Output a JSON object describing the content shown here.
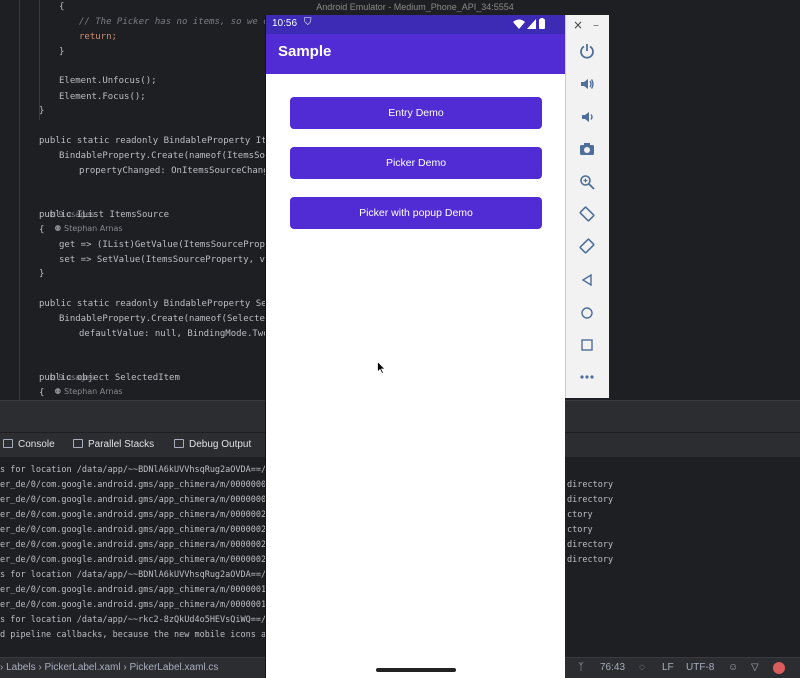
{
  "emulator": {
    "title": "Android Emulator - Medium_Phone_API_34:5554",
    "phone_time": "10:56",
    "app_title": "Sample",
    "buttons": [
      "Entry Demo",
      "Picker Demo",
      "Picker with popup Demo"
    ],
    "toolbar": {
      "close": "×",
      "minimize": "–",
      "icons": [
        "power-icon",
        "volume-up-icon",
        "volume-down-icon",
        "camera-icon",
        "zoom-icon",
        "rotate-left-icon",
        "rotate-right-icon",
        "back-icon",
        "home-icon",
        "overview-icon",
        "more-icon"
      ]
    }
  },
  "editor": {
    "lines": [
      {
        "text": "{"
      },
      {
        "comment": "// The Picker has no items, so we don'"
      },
      {
        "text": "return;"
      },
      {
        "text": "}"
      },
      {
        "text": "Element.Unfocus();"
      },
      {
        "text": "Element.Focus();"
      },
      {
        "text": "}"
      },
      {
        "text": "public static readonly BindableProperty ItemsS"
      },
      {
        "text": "BindableProperty.Create(nameof(ItemsSource"
      },
      {
        "text": "propertyChanged: OnItemsSourceChanged)"
      },
      {
        "text": "public IList ItemsSource"
      },
      {
        "text": "{"
      },
      {
        "text": "get => (IList)GetValue(ItemsSourceProperty"
      },
      {
        "text": "set => SetValue(ItemsSourceProperty, value"
      },
      {
        "text": "}"
      },
      {
        "text": "public static readonly BindableProperty Select"
      },
      {
        "text": "BindableProperty.Create(nameof(SelectedIte"
      },
      {
        "text": "defaultValue: null, BindingMode.TwoWay"
      },
      {
        "text": "public object SelectedItem"
      },
      {
        "text": "{"
      }
    ],
    "hints": [
      "9 usages",
      "Stephan Arnas"
    ]
  },
  "tool_tabs": [
    "Console",
    "Parallel Stacks",
    "Debug Output"
  ],
  "console": {
    "left_lines": [
      "s for location /data/app/~~BDNlA6kUVVhsqRug2aOVDA==/com",
      "er_de/0/com.google.android.gms/app_chimera/m/0000000f/",
      "er_de/0/com.google.android.gms/app_chimera/m/0000000f/",
      "er_de/0/com.google.android.gms/app_chimera/m/0000002a/",
      "er_de/0/com.google.android.gms/app_chimera/m/0000002a/",
      "er_de/0/com.google.android.gms/app_chimera/m/00000024/",
      "er_de/0/com.google.android.gms/app_chimera/m/00000024/",
      "s for location /data/app/~~BDNlA6kUVVhsqRug2aOVDA==/com",
      "er_de/0/com.google.android.gms/app_chimera/m/00000011/",
      "er_de/0/com.google.android.gms/app_chimera/m/00000011/",
      "s for location /data/app/~~rkc2-8zQkUd4o5HEVsQiWQ==/com",
      "d pipeline callbacks, because the new mobile icons are"
    ],
    "right_lines": [
      "directory",
      "directory",
      "ctory",
      "ctory",
      "directory",
      "directory"
    ]
  },
  "statusbar": {
    "breadcrumbs": [
      "Labels",
      "PickerLabel.xaml",
      "PickerLabel.xaml.cs"
    ],
    "position": "76:43",
    "line_ending": "LF",
    "encoding": "UTF-8"
  }
}
